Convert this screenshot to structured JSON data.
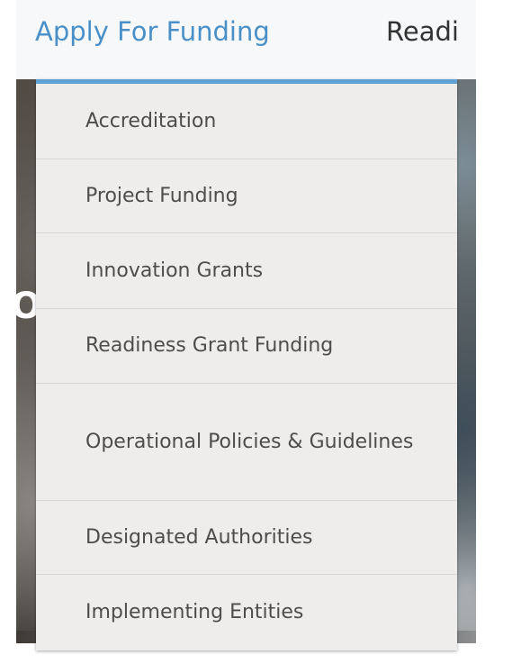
{
  "nav": {
    "active_item": "Apply For Funding",
    "next_item": "Readi"
  },
  "dropdown": {
    "items": [
      {
        "label": "Accreditation"
      },
      {
        "label": "Project Funding"
      },
      {
        "label": "Innovation Grants"
      },
      {
        "label": "Readiness Grant Funding"
      },
      {
        "label": "Operational Policies & Guidelines"
      },
      {
        "label": "Designated Authorities"
      },
      {
        "label": "Implementing Entities"
      }
    ]
  },
  "hero": {
    "partial_glyph": "O"
  },
  "colors": {
    "nav_active": "#4a90c8",
    "dropdown_accent": "#5fa3d6",
    "dropdown_bg": "#efedeb",
    "item_text": "#4d4d4d"
  }
}
